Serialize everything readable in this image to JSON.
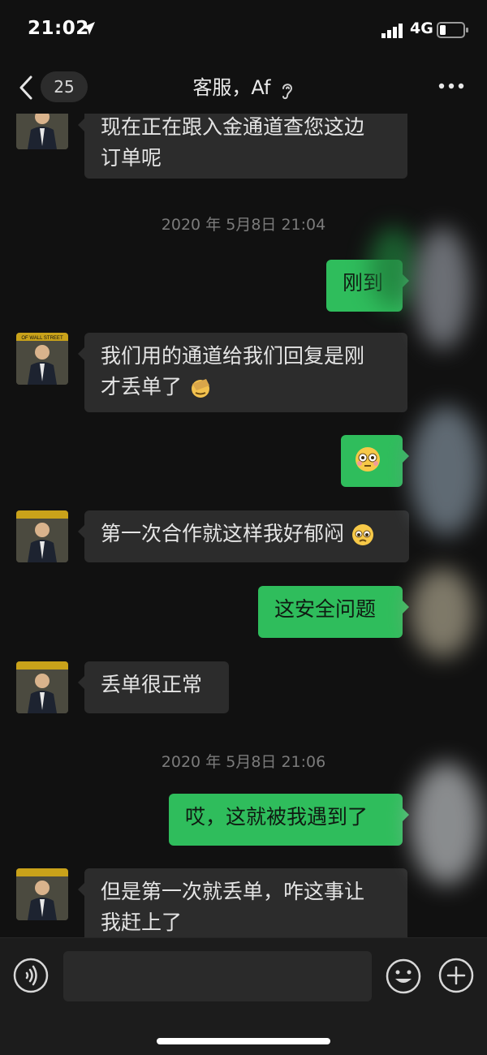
{
  "status_bar": {
    "time": "21:02",
    "network": "4G",
    "icons": [
      "location-arrow-icon",
      "signal-icon",
      "battery-icon"
    ]
  },
  "header": {
    "unread_count": "25",
    "title": "客服，Af",
    "icons": [
      "chevron-left-icon",
      "ear-icon",
      "more-icon"
    ]
  },
  "messages": [
    {
      "side": "left",
      "text1": "现在正在跟入金通道查您这边",
      "text2": "订单呢"
    },
    {
      "timestamp": "2020 年 5月8日 21:04"
    },
    {
      "side": "right",
      "text": "刚到"
    },
    {
      "side": "left",
      "text1": "我们用的通道给我们回复是刚",
      "text2": "才丢单了"
    },
    {
      "side": "right",
      "emoji": "flushed-face-icon"
    },
    {
      "side": "left",
      "text": "第一次合作就这样我好郁闷"
    },
    {
      "side": "right",
      "text": "这安全问题"
    },
    {
      "side": "left",
      "text": "丢单很正常"
    },
    {
      "timestamp": "2020 年 5月8日 21:06"
    },
    {
      "side": "right",
      "text": "哎，这就被我遇到了"
    },
    {
      "side": "left",
      "text1": "但是第一次就丢单，咋这事让",
      "text2": "我赶上了"
    }
  ],
  "avatar_caption": "OF WALL STREET",
  "input_bar": {
    "icons": [
      "voice-icon",
      "emoji-icon",
      "plus-icon"
    ]
  },
  "colors": {
    "background": "#111111",
    "incoming_bubble": "#2c2c2c",
    "outgoing_bubble": "#2fbd5c",
    "timestamp": "#7b7b7b"
  }
}
